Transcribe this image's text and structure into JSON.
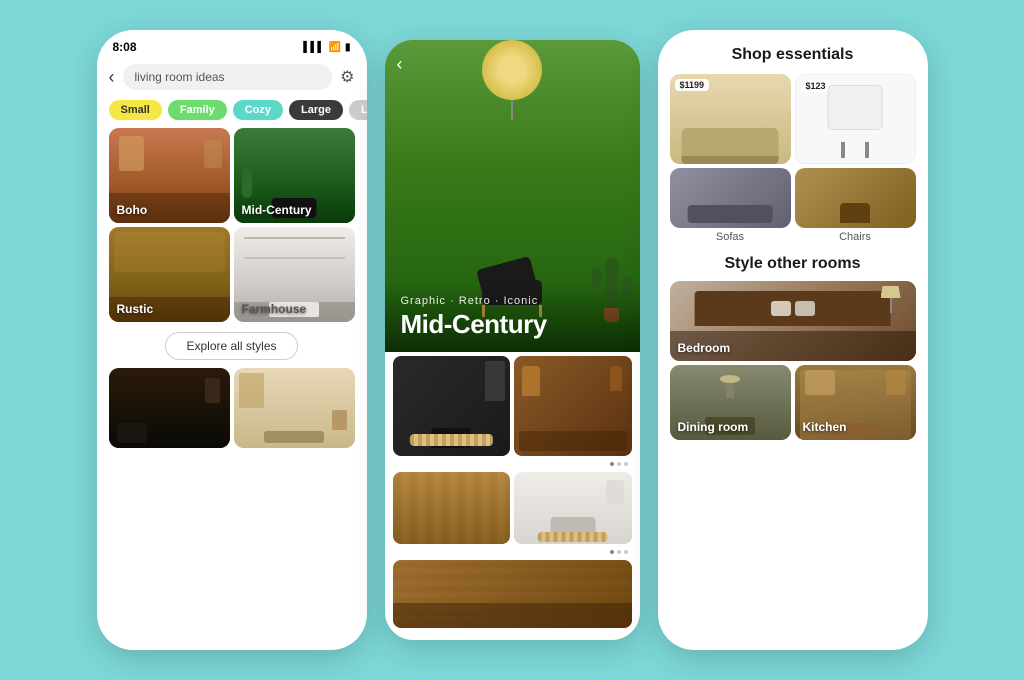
{
  "background": "#7dd8d8",
  "phones": {
    "left": {
      "status_time": "8:08",
      "search_placeholder": "living room ideas",
      "chips": [
        {
          "label": "Small",
          "style": "chip-yellow"
        },
        {
          "label": "Family",
          "style": "chip-green"
        },
        {
          "label": "Cozy",
          "style": "chip-teal"
        },
        {
          "label": "Large",
          "style": "chip-dark"
        },
        {
          "label": "Lay...",
          "style": "chip-gray"
        }
      ],
      "styles": [
        {
          "label": "Boho",
          "bg": "boho-bg"
        },
        {
          "label": "Mid-Century",
          "bg": "midcent-bg"
        },
        {
          "label": "Rustic",
          "bg": "rustic-bg"
        },
        {
          "label": "Farmhouse",
          "bg": "farm-bg"
        }
      ],
      "explore_button": "Explore all styles"
    },
    "middle": {
      "subtitle": "Graphic · Retro · Iconic",
      "title": "Mid-Century",
      "back_label": "‹"
    },
    "right": {
      "shop_title": "Shop essentials",
      "products": [
        {
          "name": "Sofas",
          "price": "$1199"
        },
        {
          "name": "Chairs",
          "price": "$123"
        }
      ],
      "style_title": "Style other rooms",
      "rooms": [
        {
          "name": "Bedroom",
          "span": "wide"
        },
        {
          "name": "Dining room",
          "span": "small"
        },
        {
          "name": "Kitchen",
          "span": "small"
        }
      ]
    }
  }
}
